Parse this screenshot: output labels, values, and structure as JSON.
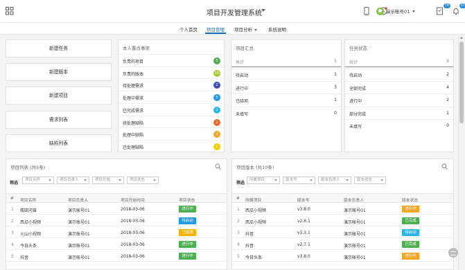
{
  "header": {
    "title": "项目开发管理系统",
    "user_name": "演示帐号01",
    "badge_tasks": "74",
    "badge_messages": "37"
  },
  "nav": {
    "items": [
      {
        "label": "个人首页"
      },
      {
        "label": "项目管理"
      },
      {
        "label": "项目分析"
      },
      {
        "label": "系统说明"
      }
    ],
    "active": "项目管理"
  },
  "quick_actions": [
    {
      "label": "新建任务"
    },
    {
      "label": "新建版本"
    },
    {
      "label": "新建项目"
    },
    {
      "label": "需求列表"
    },
    {
      "label": "缺陷列表"
    }
  ],
  "todo": {
    "title": "本人重点事项",
    "items": [
      {
        "label": "负责的项目",
        "count": "5",
        "color": "#4caf50"
      },
      {
        "label": "负责的版本",
        "count": "10",
        "color": "#a4c639"
      },
      {
        "label": "待处理需求",
        "count": "2",
        "color": "#3f51b5"
      },
      {
        "label": "处理中需求",
        "count": "5",
        "color": "#1e9be3"
      },
      {
        "label": "已完成需求",
        "count": "2",
        "color": "#29b6e8"
      },
      {
        "label": "待处理缺陷",
        "count": "2",
        "color": "#f06a2a"
      },
      {
        "label": "处理中缺陷",
        "count": "2",
        "color": "#f5a623"
      },
      {
        "label": "已处理缺陷",
        "count": "1",
        "color": "#f5d000"
      }
    ]
  },
  "project_summary": {
    "title": "项目汇总",
    "header": {
      "label": "共计",
      "value": "5"
    },
    "rows": [
      {
        "label": "待启动",
        "value": "1"
      },
      {
        "label": "进行中",
        "value": "3"
      },
      {
        "label": "已结项",
        "value": "1"
      },
      {
        "label": "未填写",
        "value": "0"
      }
    ]
  },
  "task_status": {
    "title": "任务状态",
    "header": {
      "label": "共计",
      "value": "9"
    },
    "rows": [
      {
        "label": "待启动",
        "value": "2"
      },
      {
        "label": "全部完成",
        "value": "4"
      },
      {
        "label": "进行中",
        "value": "2"
      },
      {
        "label": "部分完成",
        "value": "1"
      },
      {
        "label": "未填写",
        "value": "0"
      }
    ]
  },
  "project_list": {
    "title": "项目列表 (共5条)",
    "filter_label": "筛选",
    "filters": [
      "项目名称",
      "项目负责人",
      "项目开始...",
      "项目状态"
    ],
    "columns": [
      "#",
      "项目名称",
      "项目负责人",
      "项目开始时间",
      "项目状态"
    ],
    "rows": [
      {
        "no": "1",
        "name": "楼田河曾",
        "owner": "演示帐号01",
        "start": "2018-03-06",
        "status": "进行中",
        "color": "#4caf50"
      },
      {
        "no": "2",
        "name": "西瓜小视频",
        "owner": "演示帐号01",
        "start": "2018-03-06",
        "status": "待启动",
        "color": "#1e9be3"
      },
      {
        "no": "3",
        "name": "火山小视频",
        "owner": "演示帐号01",
        "start": "2018-03-06",
        "status": "已结项",
        "color": "#f5b400"
      },
      {
        "no": "4",
        "name": "今日头条",
        "owner": "演示帐号01",
        "start": "2018-03-06",
        "status": "进行中",
        "color": "#4caf50"
      },
      {
        "no": "5",
        "name": "抖音",
        "owner": "演示帐号01",
        "start": "2018-03-06",
        "status": "进行中",
        "color": "#4caf50"
      }
    ]
  },
  "version_list": {
    "title": "项目版本 (共10条)",
    "filter_label": "筛选",
    "filters": [
      "所属项目",
      "版本号",
      "版本负责人",
      "版本状态"
    ],
    "columns": [
      "#",
      "所属项目",
      "版本号",
      "版本负责人",
      "版本状态"
    ],
    "rows": [
      {
        "no": "1",
        "project": "西瓜小视频",
        "version": "v3.8.0",
        "owner": "演示帐号01",
        "status": "进行中",
        "color": "#f5a623"
      },
      {
        "no": "2",
        "project": "西瓜小视频",
        "version": "v2.6.1",
        "owner": "演示帐号01",
        "status": "已完成",
        "color": "#4caf50"
      },
      {
        "no": "3",
        "project": "抖音",
        "version": "v3.3.1",
        "owner": "演示帐号01",
        "status": "待启动",
        "color": "#29b6e8"
      },
      {
        "no": "4",
        "project": "抖音",
        "version": "v2.7.1",
        "owner": "演示帐号01",
        "status": "已完成",
        "color": "#4caf50"
      },
      {
        "no": "5",
        "project": "今日头条",
        "version": "v3.8.0",
        "owner": "演示帐号01",
        "status": "进行中",
        "color": "#f5a623"
      }
    ]
  }
}
